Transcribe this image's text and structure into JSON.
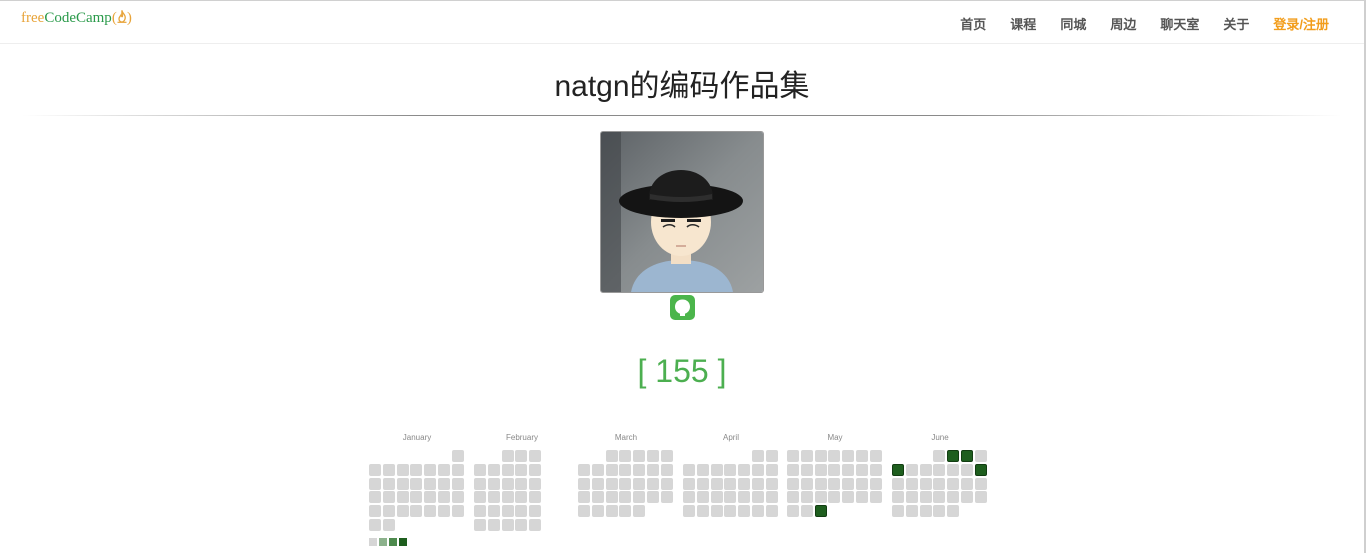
{
  "brand": {
    "free": "free",
    "code": "CodeCamp",
    "paren_open": "(",
    "paren_close": ")"
  },
  "nav": {
    "items": [
      "首页",
      "课程",
      "同城",
      "周边",
      "聊天室",
      "关于"
    ],
    "login": "登录/注册"
  },
  "page": {
    "title": "natgn的编码作品集",
    "score": "[ 155 ]"
  },
  "calendar": {
    "months": [
      "January",
      "February",
      "March",
      "April",
      "May",
      "June"
    ],
    "active_days": {
      "may": [
        {
          "week": 2,
          "day": 4,
          "level": 4
        }
      ],
      "june": [
        {
          "week": 4,
          "day": 0,
          "level": 4
        },
        {
          "week": 5,
          "day": 0,
          "level": 4
        },
        {
          "week": 0,
          "day": 1,
          "level": 4
        },
        {
          "week": 6,
          "day": 1,
          "level": 3
        }
      ]
    },
    "legend_colors": [
      "#d6d6d6",
      "#8cb28c",
      "#4d8a4d",
      "#1e5e1e"
    ]
  },
  "colors": {
    "accent_green": "#4caf50",
    "login_orange": "#f29d1b"
  },
  "icons": {
    "github": "github-icon",
    "logo": "flame-icon"
  }
}
